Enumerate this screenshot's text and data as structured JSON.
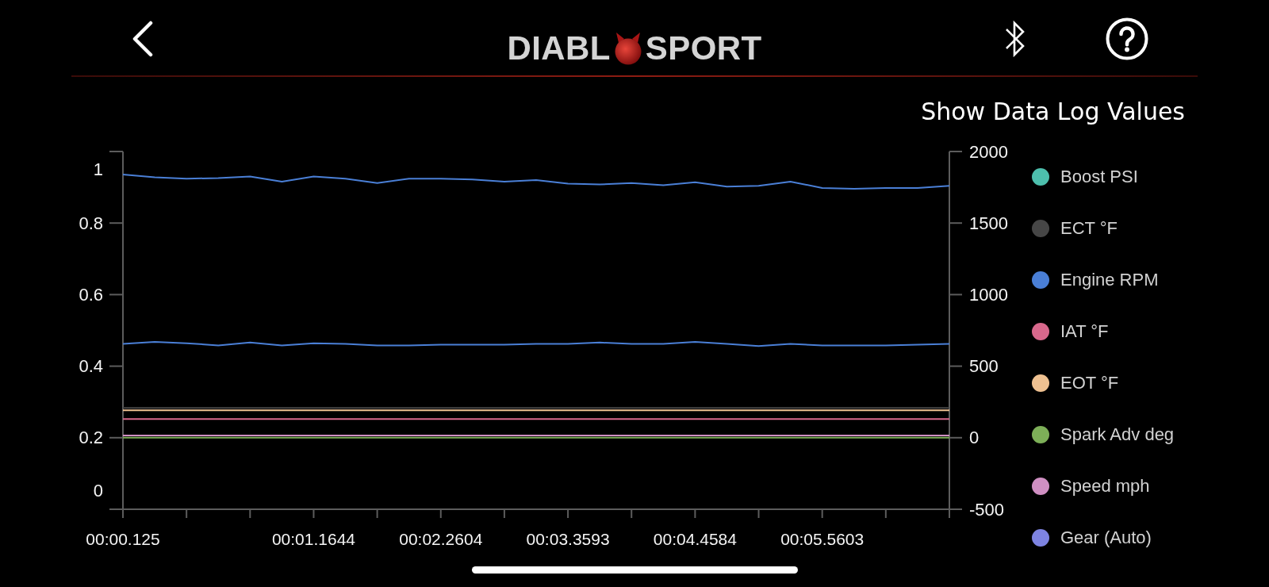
{
  "header": {
    "logo": [
      "DIABL",
      "SPORT"
    ]
  },
  "title_button": {
    "label": "Show Data Log Values"
  },
  "chart": {
    "left_axis_labels": [
      "1",
      "0.8",
      "0.6",
      "0.4",
      "0.2",
      "0"
    ],
    "chart_data": {
      "type": "line",
      "categories": [
        "00:00.125",
        null,
        null,
        null,
        null,
        null,
        "00:01.1644",
        null,
        null,
        null,
        "00:02.2604",
        null,
        null,
        null,
        "00:03.3593",
        null,
        null,
        null,
        "00:04.4584",
        null,
        null,
        null,
        "00:05.5603",
        null,
        null,
        null,
        null
      ],
      "ylim": [
        -500,
        2000
      ],
      "yticks": [
        -500,
        0,
        500,
        1000,
        1500,
        2000
      ],
      "legend": "right",
      "series": [
        {
          "name": "Boost PSI",
          "color": "#4dbfad",
          "values": [
            null,
            null,
            null,
            null,
            null,
            null,
            null,
            null,
            null,
            null,
            null,
            null,
            null,
            null,
            null,
            null,
            null,
            null,
            null,
            null,
            null,
            null,
            null,
            null,
            null,
            null,
            null
          ]
        },
        {
          "name": "ECT °F",
          "color": "#464646",
          "values": [
            208,
            208,
            208,
            208,
            208,
            208,
            208,
            208,
            208,
            208,
            208,
            208,
            208,
            208,
            208,
            208,
            208,
            208,
            208,
            208,
            208,
            208,
            208,
            208,
            208,
            208,
            208
          ]
        },
        {
          "name": "Engine RPM",
          "color": "#4a7fd6",
          "values": [
            1840,
            1820,
            1810,
            1815,
            1825,
            1790,
            1825,
            1810,
            1780,
            1810,
            1810,
            1805,
            1790,
            1800,
            1775,
            1770,
            1780,
            1765,
            1785,
            1755,
            1760,
            1790,
            1745,
            1740,
            1745,
            1745,
            1760
          ]
        },
        {
          "name": "IAT °F",
          "color": "#d8688c",
          "values": [
            130,
            130,
            130,
            130,
            130,
            130,
            130,
            130,
            130,
            130,
            130,
            130,
            130,
            130,
            130,
            130,
            130,
            130,
            130,
            130,
            130,
            130,
            130,
            130,
            130,
            130,
            130
          ]
        },
        {
          "name": "EOT °F",
          "color": "#efc191",
          "values": [
            191,
            191,
            191,
            191,
            191,
            191,
            191,
            191,
            191,
            191,
            191,
            191,
            191,
            191,
            191,
            191,
            191,
            191,
            191,
            191,
            191,
            191,
            191,
            191,
            191,
            191,
            191
          ]
        },
        {
          "name": "Spark Adv deg",
          "color": "#7daf58",
          "values": [
            0,
            0,
            0,
            0,
            0,
            0,
            0,
            0,
            0,
            0,
            0,
            0,
            0,
            0,
            0,
            0,
            0,
            0,
            0,
            0,
            0,
            0,
            0,
            0,
            0,
            0,
            0
          ]
        },
        {
          "name": "Speed mph",
          "color": "#cf8fc2",
          "values": [
            15,
            15,
            15,
            15,
            15,
            15,
            15,
            15,
            15,
            15,
            15,
            15,
            15,
            15,
            15,
            15,
            15,
            15,
            15,
            15,
            15,
            15,
            15,
            15,
            15,
            15,
            15
          ]
        },
        {
          "name": "Gear (Auto)",
          "color": "#7e84e2",
          "values": [
            null,
            null,
            null,
            null,
            null,
            null,
            null,
            null,
            null,
            null,
            null,
            null,
            null,
            null,
            null,
            null,
            null,
            null,
            null,
            null,
            null,
            null,
            null,
            null,
            null,
            null,
            null
          ]
        },
        {
          "color": "#4a7fd6",
          "values": [
            655,
            670,
            660,
            645,
            665,
            645,
            660,
            655,
            645,
            645,
            650,
            650,
            650,
            655,
            655,
            665,
            655,
            655,
            670,
            655,
            640,
            655,
            645,
            645,
            645,
            650,
            655
          ]
        }
      ]
    }
  }
}
